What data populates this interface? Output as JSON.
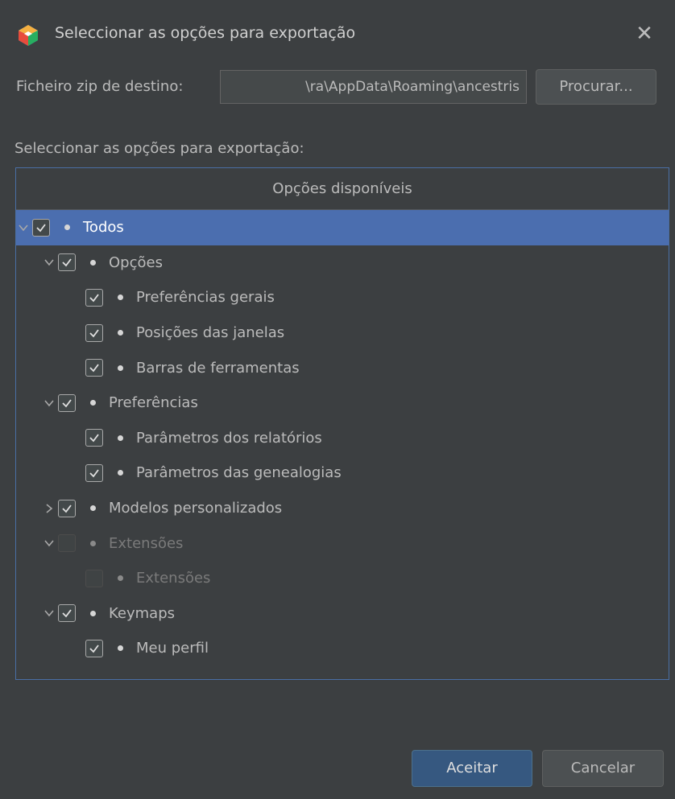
{
  "window": {
    "title": "Seleccionar as opções para exportação",
    "close_glyph": "✕",
    "app_icon": "ancestris-logo-icon"
  },
  "destination": {
    "label": "Ficheiro zip de destino:",
    "value": "ra\\AppData\\Roaming\\ancestris\\",
    "browse_label": "Procurar..."
  },
  "options_label": "Seleccionar as opções para exportação:",
  "tree": {
    "header": "Opções disponíveis",
    "rows": [
      {
        "label": "Todos",
        "level": 0,
        "expander": "down",
        "checked": true,
        "disabled": false,
        "selected": true
      },
      {
        "label": "Opções",
        "level": 1,
        "expander": "down",
        "checked": true,
        "disabled": false,
        "selected": false
      },
      {
        "label": "Preferências gerais",
        "level": 2,
        "expander": "none",
        "checked": true,
        "disabled": false,
        "selected": false
      },
      {
        "label": "Posições das janelas",
        "level": 2,
        "expander": "none",
        "checked": true,
        "disabled": false,
        "selected": false
      },
      {
        "label": "Barras de ferramentas",
        "level": 2,
        "expander": "none",
        "checked": true,
        "disabled": false,
        "selected": false
      },
      {
        "label": "Preferências",
        "level": 1,
        "expander": "down",
        "checked": true,
        "disabled": false,
        "selected": false
      },
      {
        "label": "Parâmetros dos relatórios",
        "level": 2,
        "expander": "none",
        "checked": true,
        "disabled": false,
        "selected": false
      },
      {
        "label": "Parâmetros das genealogias",
        "level": 2,
        "expander": "none",
        "checked": true,
        "disabled": false,
        "selected": false
      },
      {
        "label": "Modelos personalizados",
        "level": 1,
        "expander": "right",
        "checked": true,
        "disabled": false,
        "selected": false
      },
      {
        "label": "Extensões",
        "level": 1,
        "expander": "down",
        "checked": false,
        "disabled": true,
        "selected": false
      },
      {
        "label": "Extensões",
        "level": 2,
        "expander": "none",
        "checked": false,
        "disabled": true,
        "selected": false
      },
      {
        "label": "Keymaps",
        "level": 1,
        "expander": "down",
        "checked": true,
        "disabled": false,
        "selected": false
      },
      {
        "label": "Meu perfil",
        "level": 2,
        "expander": "none",
        "checked": true,
        "disabled": false,
        "selected": false
      }
    ]
  },
  "buttons": {
    "ok": "Aceitar",
    "cancel": "Cancelar"
  },
  "colors": {
    "background": "#3c3f41",
    "selection": "#4b6eaf",
    "primary_button": "#365880",
    "panel_border": "#4a6fa5"
  }
}
